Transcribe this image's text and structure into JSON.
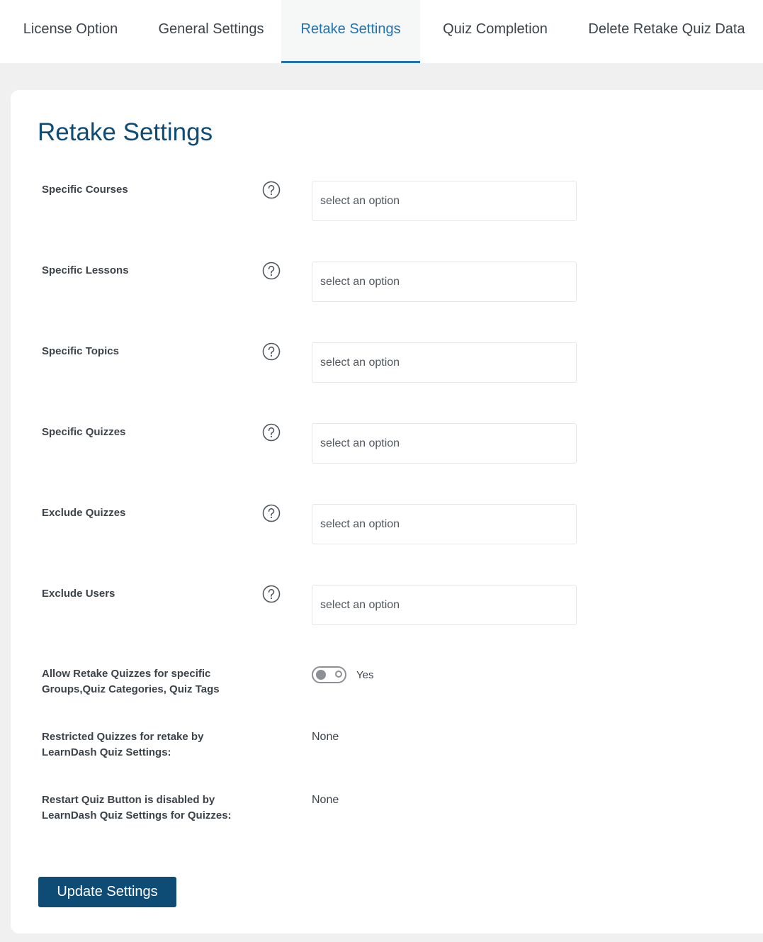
{
  "tabs": [
    {
      "label": "License Option",
      "active": false
    },
    {
      "label": "General Settings",
      "active": false
    },
    {
      "label": "Retake Settings",
      "active": true
    },
    {
      "label": "Quiz Completion",
      "active": false
    },
    {
      "label": "Delete Retake Quiz Data",
      "active": false
    }
  ],
  "page": {
    "title": "Retake Settings"
  },
  "fields": [
    {
      "label": "Specific Courses",
      "placeholder": "select an option",
      "help_icon": "question-circle-icon"
    },
    {
      "label": "Specific Lessons",
      "placeholder": "select an option",
      "help_icon": "question-circle-icon"
    },
    {
      "label": "Specific Topics",
      "placeholder": "select an option",
      "help_icon": "question-circle-icon"
    },
    {
      "label": "Specific Quizzes",
      "placeholder": "select an option",
      "help_icon": "question-circle-icon"
    },
    {
      "label": "Exclude Quizzes",
      "placeholder": "select an option",
      "help_icon": "question-circle-icon"
    },
    {
      "label": "Exclude Users",
      "placeholder": "select an option",
      "help_icon": "question-circle-icon"
    }
  ],
  "toggle_setting": {
    "label_line1": "Allow Retake Quizzes for specific",
    "label_line2": "Groups,Quiz Categories, Quiz Tags",
    "state_label": "Yes",
    "checked": false
  },
  "restricted_quizzes": {
    "label_line1": "Restricted Quizzes for retake by",
    "label_line2": "LearnDash Quiz Settings:",
    "value": "None"
  },
  "restart_disabled": {
    "label_line1": "Restart Quiz Button is disabled by",
    "label_line2": "LearnDash Quiz Settings for Quizzes:",
    "value": "None"
  },
  "actions": {
    "update_label": "Update Settings"
  },
  "colors": {
    "accent": "#2271b1",
    "title": "#0f4c75",
    "button": "#0f4c75",
    "page_background": "#f0f0f1"
  }
}
